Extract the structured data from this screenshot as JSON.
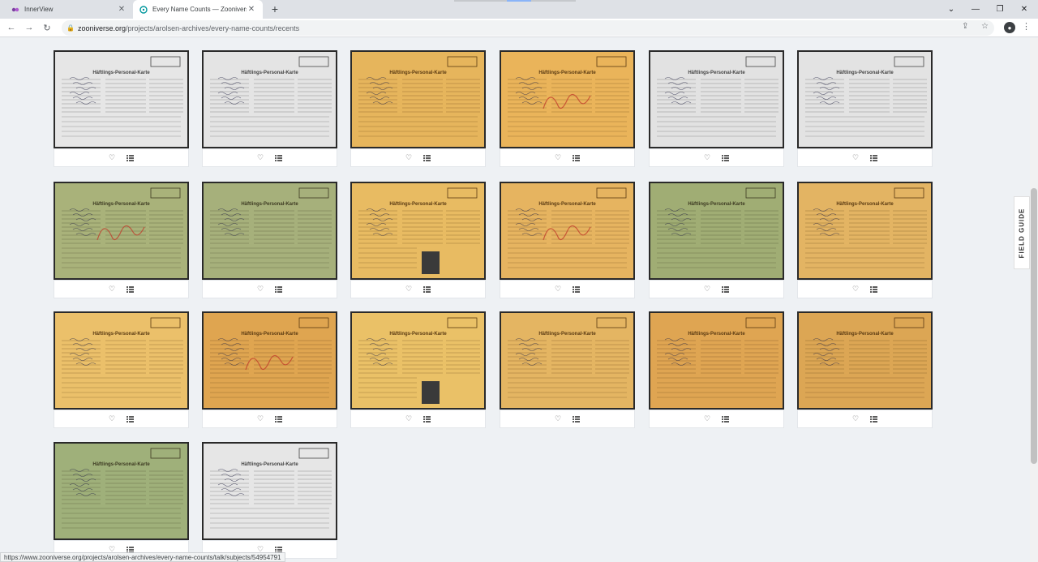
{
  "browser": {
    "tabs": [
      {
        "title": "InnerView",
        "icon": "innerview-icon"
      },
      {
        "title": "Every Name Counts — Zooniverse",
        "icon": "zooniverse-icon",
        "active": true
      }
    ],
    "url_host": "zooniverse.org",
    "url_path": "/projects/arolsen-archives/every-name-counts/recents"
  },
  "card_title": "Häftlings-Personal-Karte",
  "cards": [
    {
      "tone": "#e6e6e6",
      "ink": "#444444"
    },
    {
      "tone": "#e4e4e4",
      "ink": "#444444"
    },
    {
      "tone": "#e6b55c",
      "ink": "#5a3a12"
    },
    {
      "tone": "#eab45a",
      "ink": "#5a3a12",
      "mark": "Dora"
    },
    {
      "tone": "#e2e2e2",
      "ink": "#444444"
    },
    {
      "tone": "#e3e3e3",
      "ink": "#444444"
    },
    {
      "tone": "#a9b27a",
      "ink": "#3d3a22",
      "mark": "Dora"
    },
    {
      "tone": "#a6b07b",
      "ink": "#3d3a22"
    },
    {
      "tone": "#e8bb62",
      "ink": "#5a3a12",
      "photo": true
    },
    {
      "tone": "#e6b460",
      "ink": "#5a3a12",
      "mark": "Dora"
    },
    {
      "tone": "#a0ad74",
      "ink": "#3d3a22"
    },
    {
      "tone": "#e3b463",
      "ink": "#5a3a12"
    },
    {
      "tone": "#ebc06a",
      "ink": "#5a3a12"
    },
    {
      "tone": "#dfa550",
      "ink": "#5a3a12",
      "mark": "Dora"
    },
    {
      "tone": "#eac167",
      "ink": "#5a3a12",
      "photo": true
    },
    {
      "tone": "#e4b562",
      "ink": "#5a3a12"
    },
    {
      "tone": "#dfa552",
      "ink": "#5a3a12"
    },
    {
      "tone": "#dca654",
      "ink": "#5a3a12"
    },
    {
      "tone": "#9fb07a",
      "ink": "#3d3a22"
    },
    {
      "tone": "#e6e6e6",
      "ink": "#444444"
    }
  ],
  "field_guide_label": "FIELD GUIDE",
  "status_url": "https://www.zooniverse.org/projects/arolsen-archives/every-name-counts/talk/subjects/54954791"
}
